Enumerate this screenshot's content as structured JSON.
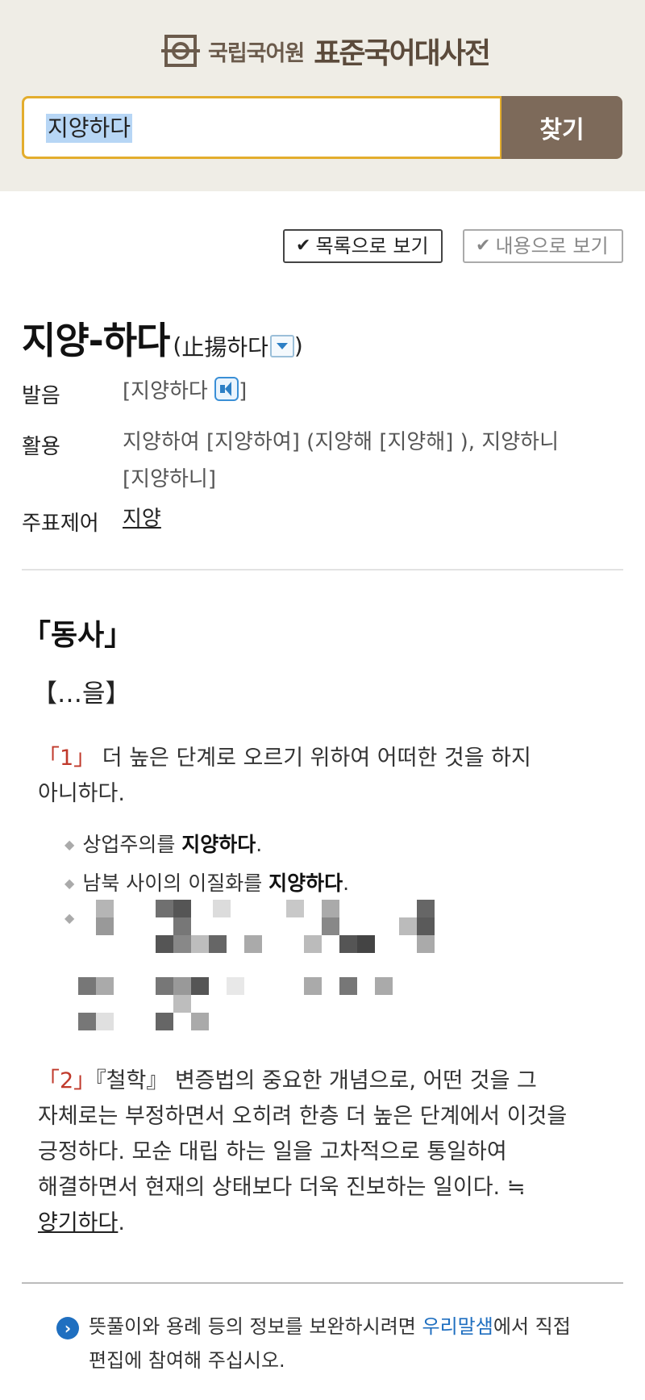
{
  "header": {
    "org_name": "국립국어원",
    "dictionary_name": "표준국어대사전",
    "search_value": "지양하다",
    "search_button": "찾기"
  },
  "view_options": {
    "list_view": "목록으로 보기",
    "content_view": "내용으로 보기"
  },
  "entry": {
    "headword": "지양-하다",
    "origin_open": "(",
    "origin_hanja": "止揚하다",
    "origin_close": ")",
    "pronunciation_label": "발음",
    "pronunciation": "[지양하다",
    "pronunciation_close": "]",
    "inflection_label": "활용",
    "inflection_line1": "지양하여 [지양하여] (지양해 [지양해] ), 지양하니",
    "inflection_line2": "[지양하니]",
    "main_entry_label": "주표제어",
    "main_entry": "지양",
    "part_of_speech": "「동사」",
    "pattern": "【…을】",
    "senses": [
      {
        "number": "「1」",
        "definition_line1": " 더 높은 단계로 오르기 위하여 어떠한 것을 하지",
        "definition_line2": "아니하다.",
        "examples": [
          {
            "before": "상업주의를 ",
            "bold": "지양하다",
            "after": "."
          },
          {
            "before": "남북 사이의 이질화를 ",
            "bold": "지양하다",
            "after": "."
          }
        ]
      },
      {
        "number": "「2」",
        "field": "『철학』",
        "definition_line1": " 변증법의 중요한 개념으로, 어떤 것을 그",
        "definition_line2": "자체로는 부정하면서 오히려 한층 더 높은 단계에서 이것을",
        "definition_line3": "긍정하다. 모순 대립 하는 일을 고차적으로 통일하여",
        "definition_line4": "해결하면서 현재의 상태보다 더욱 진보하는 일이다. ≒",
        "synonym": "양기하다",
        "synonym_after": "."
      }
    ]
  },
  "notice": {
    "before": "뜻풀이와 용례 등의 정보를 보완하시려면 ",
    "link": "우리말샘",
    "after_line1": "에서 직접",
    "line2": "편집에 참여해 주십시오."
  },
  "colors": {
    "header_bg": "#efede6",
    "search_border": "#e3ad2d",
    "search_button_bg": "#7d6a5a",
    "sense_number": "#c0392b",
    "link_blue": "#1f6fc0"
  },
  "icons": [
    "dictionary-logo-icon",
    "checkmark-icon",
    "dropdown-icon",
    "speaker-icon",
    "chevron-right-icon"
  ]
}
